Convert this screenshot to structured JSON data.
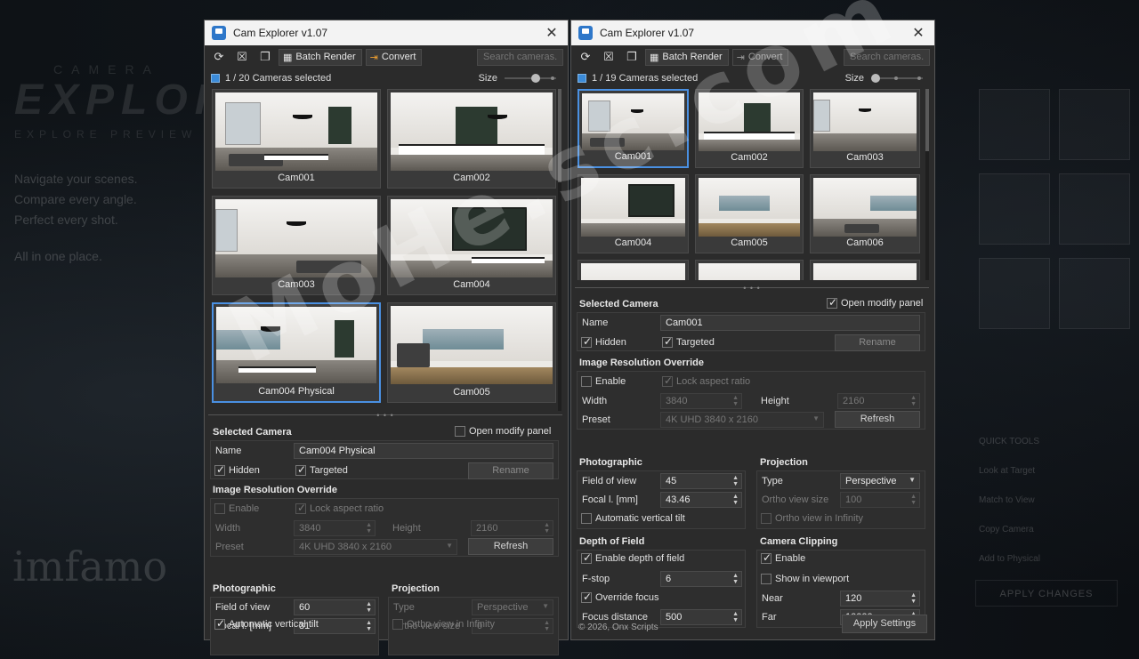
{
  "background": {
    "brand_top": "CAMERA",
    "brand_main": "EXPLOR",
    "brand_sub": "EXPLORE PREVIEW PERFE",
    "lines": [
      "Navigate your scenes.",
      "Compare every angle.",
      "Perfect every shot."
    ],
    "last_line": "All in one place.",
    "imf": "imfamo",
    "right_tools_title": "QUICK TOOLS",
    "right_tools": [
      "Look at Target",
      "Match to View",
      "Copy Camera",
      "Add to Physical"
    ],
    "right_apply": "APPLY CHANGES"
  },
  "watermark": "MoHe.sc.com",
  "left": {
    "title": "Cam Explorer v1.07",
    "toolbar": {
      "batch_render": "Batch Render",
      "convert": "Convert",
      "search_placeholder": "Search cameras..."
    },
    "status": "1 / 20 Cameras selected",
    "size_label": "Size",
    "cameras": [
      "Cam001",
      "Cam002",
      "Cam003",
      "Cam004",
      "Cam004 Physical",
      "Cam005"
    ],
    "selected": {
      "heading": "Selected Camera",
      "open_modify": "Open modify panel",
      "name_label": "Name",
      "name_value": "Cam004 Physical",
      "hidden": "Hidden",
      "targeted": "Targeted",
      "rename": "Rename"
    },
    "resolution": {
      "heading": "Image Resolution Override",
      "enable": "Enable",
      "lock": "Lock aspect ratio",
      "width_label": "Width",
      "width_value": "3840",
      "height_label": "Height",
      "height_value": "2160",
      "preset_label": "Preset",
      "preset_value": "4K UHD 3840 x 2160",
      "refresh": "Refresh"
    },
    "photographic": {
      "heading": "Photographic",
      "fov_label": "Field of view",
      "fov_value": "60",
      "focal_label": "Focal l. [mm]",
      "focal_value": "31",
      "auto_tilt": "Automatic vertical tilt"
    },
    "projection": {
      "heading": "Projection",
      "type_label": "Type",
      "type_value": "Perspective",
      "ortho_label": "Ortho view size",
      "ortho_value": "0",
      "ortho_inf": "Ortho view in Infinity"
    }
  },
  "right": {
    "title": "Cam Explorer v1.07",
    "toolbar": {
      "batch_render": "Batch Render",
      "convert": "Convert",
      "search_placeholder": "Search cameras..."
    },
    "status": "1 / 19 Cameras selected",
    "size_label": "Size",
    "cameras": [
      "Cam001",
      "Cam002",
      "Cam003",
      "Cam004",
      "Cam005",
      "Cam006"
    ],
    "selected": {
      "heading": "Selected Camera",
      "open_modify": "Open modify panel",
      "name_label": "Name",
      "name_value": "Cam001",
      "hidden": "Hidden",
      "targeted": "Targeted",
      "rename": "Rename"
    },
    "resolution": {
      "heading": "Image Resolution Override",
      "enable": "Enable",
      "lock": "Lock aspect ratio",
      "width_label": "Width",
      "width_value": "3840",
      "height_label": "Height",
      "height_value": "2160",
      "preset_label": "Preset",
      "preset_value": "4K UHD 3840 x 2160",
      "refresh": "Refresh"
    },
    "photographic": {
      "heading": "Photographic",
      "fov_label": "Field of view",
      "fov_value": "45",
      "focal_label": "Focal l. [mm]",
      "focal_value": "43.46",
      "auto_tilt": "Automatic vertical tilt"
    },
    "projection": {
      "heading": "Projection",
      "type_label": "Type",
      "type_value": "Perspective",
      "ortho_label": "Ortho view size",
      "ortho_value": "100",
      "ortho_inf": "Ortho view in Infinity"
    },
    "dof": {
      "heading": "Depth of Field",
      "enable": "Enable depth of field",
      "fstop_label": "F-stop",
      "fstop_value": "6",
      "override_focus": "Override focus",
      "focus_label": "Focus distance",
      "focus_value": "500"
    },
    "clipping": {
      "heading": "Camera Clipping",
      "enable": "Enable",
      "show_viewport": "Show in viewport",
      "near_label": "Near",
      "near_value": "120",
      "far_label": "Far",
      "far_value": "10000"
    },
    "copyright": "© 2026, Onx Scripts",
    "apply": "Apply Settings"
  }
}
